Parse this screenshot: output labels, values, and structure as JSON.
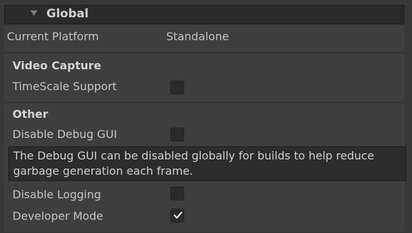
{
  "header": {
    "title": "Global"
  },
  "platform": {
    "label": "Current Platform",
    "value": "Standalone"
  },
  "video_capture": {
    "title": "Video Capture",
    "timescale_label": "TimeScale Support",
    "timescale_checked": false
  },
  "other": {
    "title": "Other",
    "disable_debug_gui_label": "Disable Debug GUI",
    "disable_debug_gui_checked": false,
    "help_text": "The Debug GUI can be disabled globally for builds to help reduce garbage generation each frame.",
    "disable_logging_label": "Disable Logging",
    "disable_logging_checked": false,
    "developer_mode_label": "Developer Mode",
    "developer_mode_checked": true
  },
  "colors": {
    "background": "#383838",
    "panel": "#3e3e3e",
    "header": "#2a2a2a",
    "checkbox": "#2a2a2a",
    "text": "#c4c4c4"
  }
}
